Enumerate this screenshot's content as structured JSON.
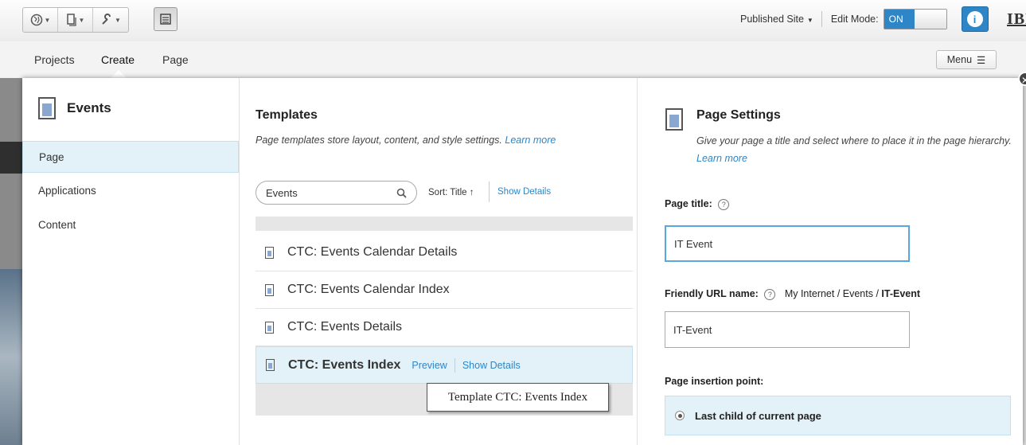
{
  "toolbar": {
    "tool_icons": [
      "globe-icon",
      "page-icon",
      "wrench-icon"
    ],
    "active_tool_icon": "calendar-icon",
    "published_label": "Published Site",
    "edit_mode_label": "Edit Mode:",
    "edit_mode_value": "ON",
    "info_icon": "i",
    "brand": "IBM"
  },
  "nav": {
    "tabs": [
      "Projects",
      "Create",
      "Page"
    ],
    "active_tab": "Create",
    "menu_label": "Menu"
  },
  "left": {
    "title": "Events",
    "items": [
      {
        "label": "Page",
        "selected": true
      },
      {
        "label": "Applications",
        "selected": false
      },
      {
        "label": "Content",
        "selected": false
      }
    ]
  },
  "templates": {
    "title": "Templates",
    "description": "Page templates store layout, content, and style settings.",
    "learn_more": "Learn more",
    "search_value": "Events",
    "sort_label": "Sort: Title",
    "show_details_label": "Show Details",
    "rows": [
      {
        "name": "CTC: Events Calendar Details"
      },
      {
        "name": "CTC: Events Calendar Index"
      },
      {
        "name": "CTC: Events Details"
      },
      {
        "name": "CTC: Events Index",
        "preview": "Preview",
        "show_details": "Show Details",
        "selected": true
      }
    ],
    "tooltip": "Template CTC: Events Index"
  },
  "settings": {
    "title": "Page Settings",
    "description": "Give your page a title and select where to place it in the page hierarchy.",
    "learn_more": "Learn more",
    "page_title_label": "Page title:",
    "page_title_value": "IT Event",
    "friendly_url_label": "Friendly URL name:",
    "url_path_prefix": "My Internet / Events /",
    "url_path_last": "IT-Event",
    "friendly_url_value": "IT-Event",
    "insertion_label": "Page insertion point:",
    "insertion_option": "Last child of current page"
  },
  "colors": {
    "accent": "#2e86c7",
    "selected_bg": "#e3f1f8"
  }
}
